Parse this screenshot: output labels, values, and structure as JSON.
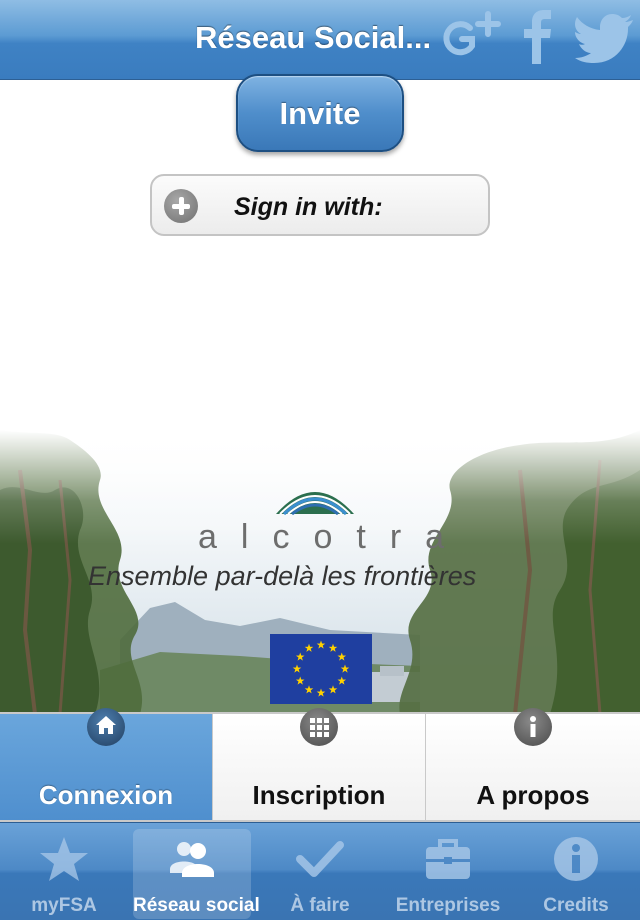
{
  "navbar": {
    "title": "Réseau Social...",
    "social_icons": [
      "google-plus-icon",
      "facebook-icon",
      "twitter-icon"
    ]
  },
  "invite": {
    "label": "Invite"
  },
  "signin": {
    "label": "Sign in with:"
  },
  "banner": {
    "logo_word": "alcotra",
    "tagline": "Ensemble par-delà les frontières"
  },
  "segments": [
    {
      "label": "Connexion",
      "icon": "home-icon",
      "active": true
    },
    {
      "label": "Inscription",
      "icon": "grid-icon",
      "active": false
    },
    {
      "label": "A propos",
      "icon": "info-icon",
      "active": false
    }
  ],
  "tabbar": [
    {
      "label": "myFSA",
      "icon": "star-icon"
    },
    {
      "label": "Réseau social",
      "icon": "people-icon",
      "selected": true
    },
    {
      "label": "À faire",
      "icon": "checkmark-icon"
    },
    {
      "label": "Entreprises",
      "icon": "briefcase-icon"
    },
    {
      "label": "Credits",
      "icon": "info-icon"
    }
  ],
  "colors": {
    "navbar_blue": "#4f8ecb",
    "active_segment": "#5a99d4",
    "eu_blue": "#1f3fa0",
    "eu_star": "#ffd100"
  }
}
